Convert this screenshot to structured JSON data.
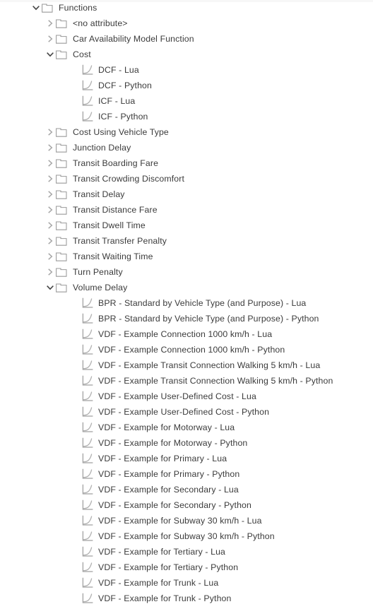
{
  "panel": {
    "name": "functions-tree-panel",
    "background": "#ffffff",
    "text_color": "#3b3b3b",
    "icon_color": "#8a8a8a",
    "chevron_expanded_color": "#444444",
    "chevron_collapsed_color": "#a6a6a6"
  },
  "icons": {
    "folder": "folder-icon",
    "function": "function-curve-icon",
    "chevron_down": "chevron-down-icon",
    "chevron_right": "chevron-right-icon"
  },
  "tree": [
    {
      "label": "Functions",
      "level": 1,
      "type": "folder",
      "state": "expanded"
    },
    {
      "label": "<no attribute>",
      "level": 2,
      "type": "folder",
      "state": "collapsed"
    },
    {
      "label": "Car Availability Model Function",
      "level": 2,
      "type": "folder",
      "state": "collapsed"
    },
    {
      "label": "Cost",
      "level": 2,
      "type": "folder",
      "state": "expanded"
    },
    {
      "label": "DCF - Lua",
      "level": 3,
      "type": "function",
      "state": "leaf"
    },
    {
      "label": "DCF - Python",
      "level": 3,
      "type": "function",
      "state": "leaf"
    },
    {
      "label": "ICF - Lua",
      "level": 3,
      "type": "function",
      "state": "leaf"
    },
    {
      "label": "ICF - Python",
      "level": 3,
      "type": "function",
      "state": "leaf"
    },
    {
      "label": "Cost Using Vehicle Type",
      "level": 2,
      "type": "folder",
      "state": "collapsed"
    },
    {
      "label": "Junction Delay",
      "level": 2,
      "type": "folder",
      "state": "collapsed"
    },
    {
      "label": "Transit Boarding Fare",
      "level": 2,
      "type": "folder",
      "state": "collapsed"
    },
    {
      "label": "Transit Crowding Discomfort",
      "level": 2,
      "type": "folder",
      "state": "collapsed"
    },
    {
      "label": "Transit Delay",
      "level": 2,
      "type": "folder",
      "state": "collapsed"
    },
    {
      "label": "Transit Distance Fare",
      "level": 2,
      "type": "folder",
      "state": "collapsed"
    },
    {
      "label": "Transit Dwell Time",
      "level": 2,
      "type": "folder",
      "state": "collapsed"
    },
    {
      "label": "Transit Transfer Penalty",
      "level": 2,
      "type": "folder",
      "state": "collapsed"
    },
    {
      "label": "Transit Waiting Time",
      "level": 2,
      "type": "folder",
      "state": "collapsed"
    },
    {
      "label": "Turn Penalty",
      "level": 2,
      "type": "folder",
      "state": "collapsed"
    },
    {
      "label": "Volume Delay",
      "level": 2,
      "type": "folder",
      "state": "expanded"
    },
    {
      "label": "BPR - Standard by Vehicle Type (and Purpose) - Lua",
      "level": 3,
      "type": "function",
      "state": "leaf"
    },
    {
      "label": "BPR - Standard by Vehicle Type (and Purpose) - Python",
      "level": 3,
      "type": "function",
      "state": "leaf"
    },
    {
      "label": "VDF - Example Connection 1000 km/h - Lua",
      "level": 3,
      "type": "function",
      "state": "leaf"
    },
    {
      "label": "VDF - Example Connection 1000 km/h - Python",
      "level": 3,
      "type": "function",
      "state": "leaf"
    },
    {
      "label": "VDF - Example Transit Connection Walking 5 km/h - Lua",
      "level": 3,
      "type": "function",
      "state": "leaf"
    },
    {
      "label": "VDF - Example Transit Connection Walking 5 km/h - Python",
      "level": 3,
      "type": "function",
      "state": "leaf"
    },
    {
      "label": "VDF - Example User-Defined Cost - Lua",
      "level": 3,
      "type": "function",
      "state": "leaf"
    },
    {
      "label": "VDF - Example User-Defined Cost - Python",
      "level": 3,
      "type": "function",
      "state": "leaf"
    },
    {
      "label": "VDF - Example for Motorway - Lua",
      "level": 3,
      "type": "function",
      "state": "leaf"
    },
    {
      "label": "VDF - Example for Motorway - Python",
      "level": 3,
      "type": "function",
      "state": "leaf"
    },
    {
      "label": "VDF - Example for Primary - Lua",
      "level": 3,
      "type": "function",
      "state": "leaf"
    },
    {
      "label": "VDF - Example for Primary - Python",
      "level": 3,
      "type": "function",
      "state": "leaf"
    },
    {
      "label": "VDF - Example for Secondary - Lua",
      "level": 3,
      "type": "function",
      "state": "leaf"
    },
    {
      "label": "VDF - Example for Secondary - Python",
      "level": 3,
      "type": "function",
      "state": "leaf"
    },
    {
      "label": "VDF - Example for Subway 30 km/h - Lua",
      "level": 3,
      "type": "function",
      "state": "leaf"
    },
    {
      "label": "VDF - Example for Subway 30 km/h - Python",
      "level": 3,
      "type": "function",
      "state": "leaf"
    },
    {
      "label": "VDF - Example for Tertiary - Lua",
      "level": 3,
      "type": "function",
      "state": "leaf"
    },
    {
      "label": "VDF - Example for Tertiary - Python",
      "level": 3,
      "type": "function",
      "state": "leaf"
    },
    {
      "label": "VDF - Example for Trunk - Lua",
      "level": 3,
      "type": "function",
      "state": "leaf"
    },
    {
      "label": "VDF - Example for Trunk - Python",
      "level": 3,
      "type": "function",
      "state": "leaf"
    }
  ]
}
